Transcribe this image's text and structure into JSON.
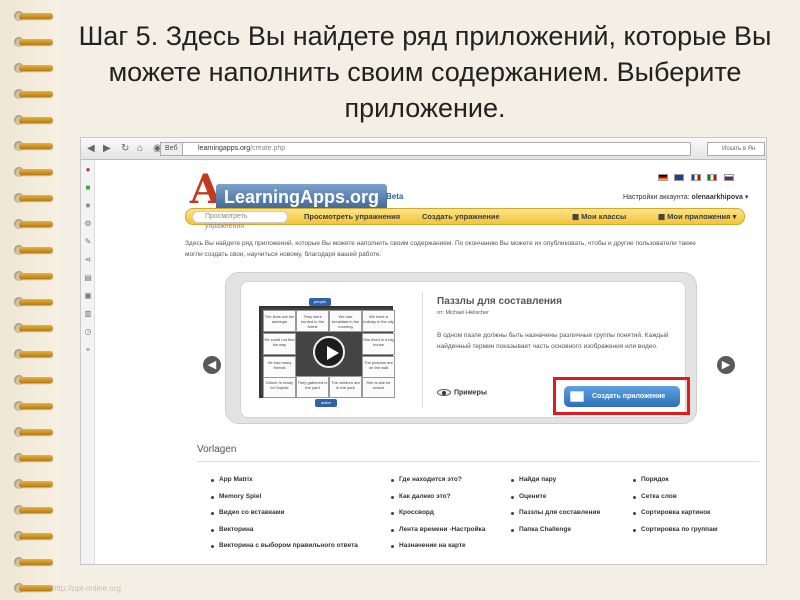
{
  "slide": {
    "title": "Шаг 5. Здесь Вы найдете ряд приложений, которые Вы можете наполнить своим содержанием. Выберите приложение.",
    "footer_url": "http://ppt-online.org"
  },
  "browser": {
    "tab_chip": "Веб",
    "url_domain": "learningapps.org",
    "url_path": "/create.php",
    "search_placeholder": "Искать в Ян"
  },
  "site": {
    "logo": "LearningApps.org",
    "logo_beta": "Beta",
    "account_label": "Настройки аккаунта:",
    "account_user": "olenaarkhipova",
    "menu": {
      "search_placeholder": "Просмотреть упражнения",
      "browse": "Просмотреть упражнения",
      "create": "Создать упражнение",
      "classes": "Мои классы",
      "apps": "Мои приложения"
    },
    "intro": "Здесь Вы найдете ряд приложений, которые Вы можете наполнить своим содержанием. По окончанию Вы можете их опубликовать, чтобы и другие пользователи также могли создать свои, научиться новому, благодаря вашей работе.",
    "featured": {
      "title": "Паззлы для составления",
      "author": "от: Michael Hielscher",
      "description": "В одном пазле должны быть назначены различные группы понятий. Каждый найденный термин показывает часть основного изображения или видео.",
      "examples": "Примеры",
      "create_button": "Создать приложение",
      "puzzle_top_tab": "people",
      "puzzle_bottom_tab": "active",
      "pieces": [
        "The lions eat the antelope",
        "They were hunted in the forest",
        "We had breakfast in the morning",
        "We have a holiday in the city",
        "He could not find his way",
        "She lived in a big house",
        "He had many friends",
        "The pictures are on the wall",
        "Dinner is ready for Sophie",
        "They gathered in the yard",
        "The children are in the park",
        "She is late for school"
      ]
    },
    "vorlagen_title": "Vorlagen",
    "vorlagen_columns": [
      [
        "App Matrix",
        "Memory Spiel",
        "Видео со вставками",
        "Викторина",
        "Викторина с выбором правильного ответа"
      ],
      [
        "Где находится это?",
        "Как далеко это?",
        "Кроссворд",
        "Лента времени -Настройка",
        "Назначение на карте"
      ],
      [
        "Найди пару",
        "Оцените",
        "Паззлы для составления",
        "Папка Challenge"
      ],
      [
        "Порядок",
        "Сетка слов",
        "Сортировка картинок",
        "Сортировка по группам"
      ]
    ]
  }
}
